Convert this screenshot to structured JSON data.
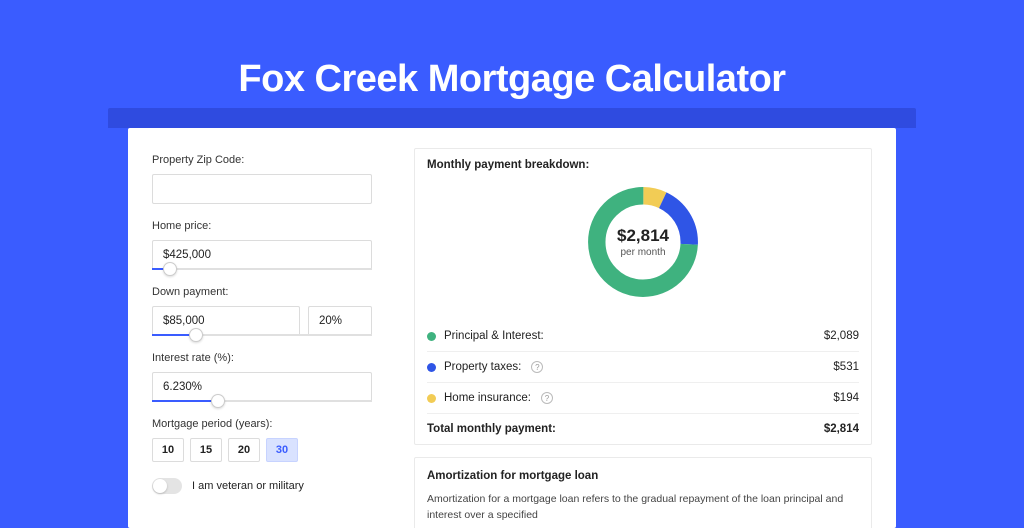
{
  "hero": {
    "title": "Fox Creek Mortgage Calculator"
  },
  "form": {
    "zip": {
      "label": "Property Zip Code:",
      "value": ""
    },
    "price": {
      "label": "Home price:",
      "value": "$425,000",
      "slider_pct": 8
    },
    "down": {
      "label": "Down payment:",
      "amount": "$85,000",
      "pct": "20%",
      "slider_pct": 20
    },
    "rate": {
      "label": "Interest rate (%):",
      "value": "6.230%",
      "slider_pct": 30
    },
    "period": {
      "label": "Mortgage period (years):",
      "options": [
        "10",
        "15",
        "20",
        "30"
      ],
      "selected": "30"
    },
    "veteran": {
      "label": "I am veteran or military",
      "on": false
    }
  },
  "breakdown": {
    "title": "Monthly payment breakdown:",
    "center_amount": "$2,814",
    "center_sub": "per month",
    "rows": [
      {
        "label": "Principal & Interest:",
        "value": "$2,089",
        "color": "#3fb27f",
        "help": false
      },
      {
        "label": "Property taxes:",
        "value": "$531",
        "color": "#2f55e6",
        "help": true
      },
      {
        "label": "Home insurance:",
        "value": "$194",
        "color": "#f2cc55",
        "help": true
      }
    ],
    "total": {
      "label": "Total monthly payment:",
      "value": "$2,814"
    }
  },
  "chart_data": {
    "type": "pie",
    "title": "Monthly payment breakdown",
    "series": [
      {
        "name": "Principal & Interest",
        "value": 2089,
        "color": "#3fb27f"
      },
      {
        "name": "Property taxes",
        "value": 531,
        "color": "#2f55e6"
      },
      {
        "name": "Home insurance",
        "value": 194,
        "color": "#f2cc55"
      }
    ],
    "total": 2814
  },
  "amort": {
    "title": "Amortization for mortgage loan",
    "text": "Amortization for a mortgage loan refers to the gradual repayment of the loan principal and interest over a specified"
  },
  "colors": {
    "accent": "#3a5cff"
  }
}
